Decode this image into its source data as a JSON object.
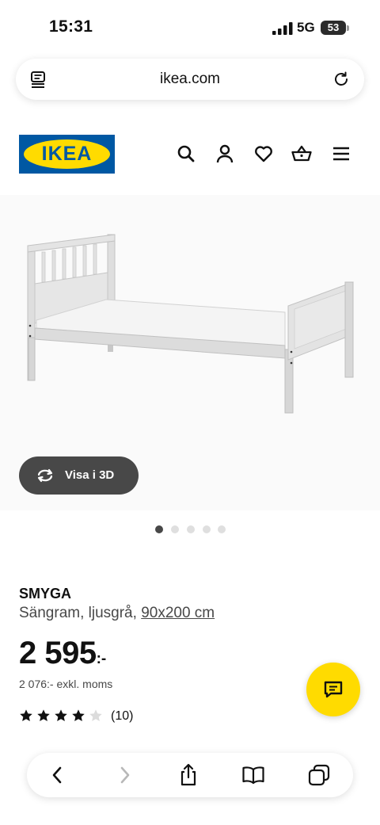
{
  "status_bar": {
    "time": "15:31",
    "network": "5G",
    "battery": "53"
  },
  "browser": {
    "url": "ikea.com"
  },
  "header": {
    "logo_text": "IKEA",
    "icons": [
      "search-icon",
      "account-icon",
      "heart-icon",
      "basket-icon",
      "menu-icon"
    ]
  },
  "product": {
    "view3d_label": "Visa i 3D",
    "carousel": {
      "count": 5,
      "active": 1
    },
    "name": "SMYGA",
    "description": "Sängram, ljusgrå,",
    "size_link": "90x200 cm",
    "price": "2 595",
    "price_suffix": ":-",
    "price_ex_vat": "2 076:- exkl. moms",
    "rating": {
      "value": 4,
      "max": 5,
      "count_text": "(10)"
    }
  },
  "toolbar": {
    "icons": [
      "back-icon",
      "forward-icon",
      "share-icon",
      "bookmarks-icon",
      "tabs-icon"
    ]
  },
  "colors": {
    "brand_blue": "#0058a3",
    "brand_yellow": "#ffdb00",
    "dark_gray": "#484848"
  }
}
